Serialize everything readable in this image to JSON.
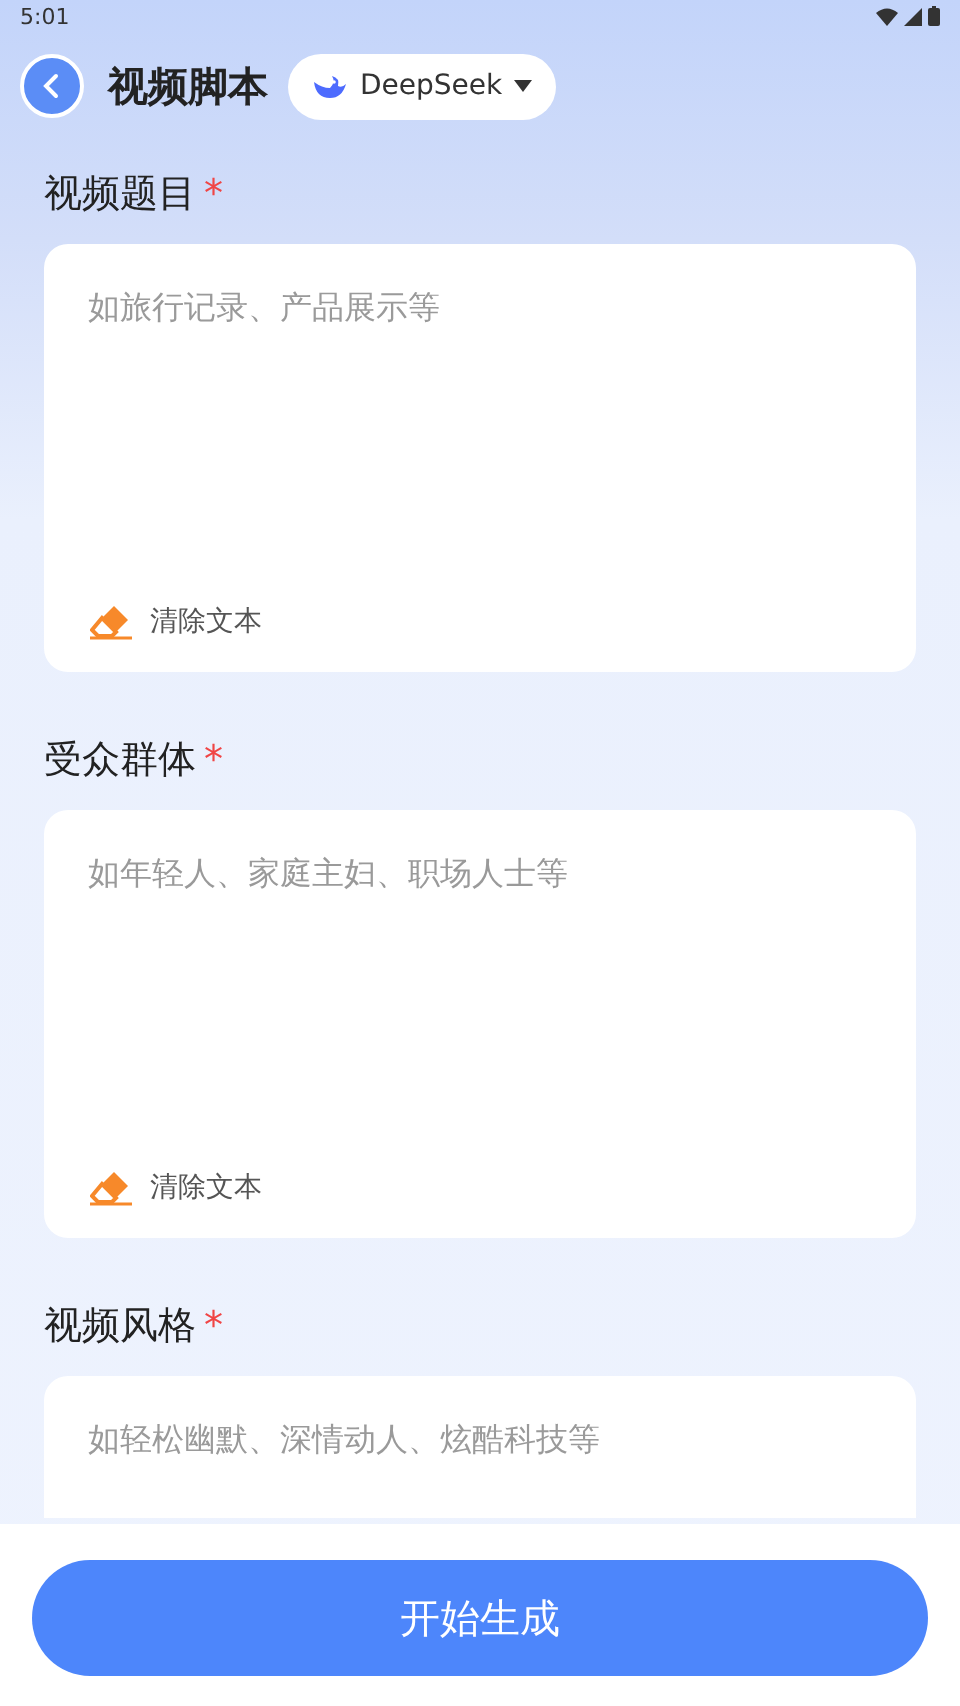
{
  "status_bar": {
    "time": "5:01"
  },
  "header": {
    "title": "视频脚本",
    "model": "DeepSeek"
  },
  "fields": [
    {
      "label": "视频题目",
      "required_mark": "*",
      "placeholder": "如旅行记录、产品展示等",
      "clear_label": "清除文本"
    },
    {
      "label": "受众群体",
      "required_mark": "*",
      "placeholder": "如年轻人、家庭主妇、职场人士等",
      "clear_label": "清除文本"
    },
    {
      "label": "视频风格",
      "required_mark": "*",
      "placeholder": "如轻松幽默、深情动人、炫酷科技等"
    }
  ],
  "primary_button": "开始生成"
}
